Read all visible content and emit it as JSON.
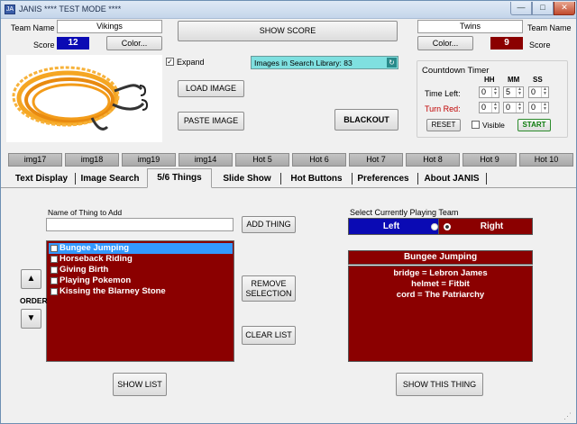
{
  "window": {
    "title": "JANIS    **** TEST MODE ****",
    "icon_text": "JA",
    "min_glyph": "—",
    "max_glyph": "□",
    "close_glyph": "✕"
  },
  "left_team": {
    "name_label": "Team Name",
    "name": "Vikings",
    "score_label": "Score",
    "score": "12",
    "color_button": "Color...",
    "score_color": "#0a0ab4"
  },
  "right_team": {
    "name_label": "Team Name",
    "name": "Twins",
    "score_label": "Score",
    "score": "9",
    "color_button": "Color...",
    "score_color": "#8b0000"
  },
  "show_score_button": "SHOW SCORE",
  "expand_checkbox": {
    "label": "Expand",
    "checked": true
  },
  "search_library": {
    "text": "Images in Search Library: 83"
  },
  "load_image_button": "LOAD IMAGE",
  "paste_image_button": "PASTE IMAGE",
  "blackout_button": "BLACKOUT",
  "countdown": {
    "title": "Countdown Timer",
    "col_hh": "HH",
    "col_mm": "MM",
    "col_ss": "SS",
    "time_left_label": "Time Left:",
    "turn_red_label": "Turn Red:",
    "time_left": {
      "hh": "0",
      "mm": "5",
      "ss": "0"
    },
    "turn_red": {
      "hh": "0",
      "mm": "0",
      "ss": "0"
    },
    "reset_button": "RESET",
    "visible_label": "Visible",
    "start_button": "START"
  },
  "hotkeys": [
    "img17",
    "img18",
    "img19",
    "img14",
    "Hot 5",
    "Hot 6",
    "Hot 7",
    "Hot 8",
    "Hot 9",
    "Hot 10"
  ],
  "tabs": [
    "Text Display",
    "Image Search",
    "5/6 Things",
    "Slide Show",
    "Hot Buttons",
    "Preferences",
    "About JANIS"
  ],
  "active_tab": "5/6 Things",
  "things": {
    "add_label": "Name of Thing to Add",
    "add_value": "",
    "add_button": "ADD THING",
    "remove_button": "REMOVE SELECTION",
    "clear_button": "CLEAR LIST",
    "show_list_button": "SHOW LIST",
    "order_label": "ORDER",
    "items": [
      "Bungee Jumping",
      "Horseback Riding",
      "Giving Birth",
      "Playing Pokemon",
      "Kissing the Blarney Stone"
    ],
    "selected_index": 0
  },
  "playing_team": {
    "label": "Select Currently Playing Team",
    "left": "Left",
    "right": "Right",
    "selected": "Right"
  },
  "thing_detail": {
    "title": "Bungee Jumping",
    "lines": [
      "bridge = Lebron James",
      "helmet = Fitbit",
      "cord = The Patriarchy"
    ],
    "show_button": "SHOW THIS THING"
  }
}
